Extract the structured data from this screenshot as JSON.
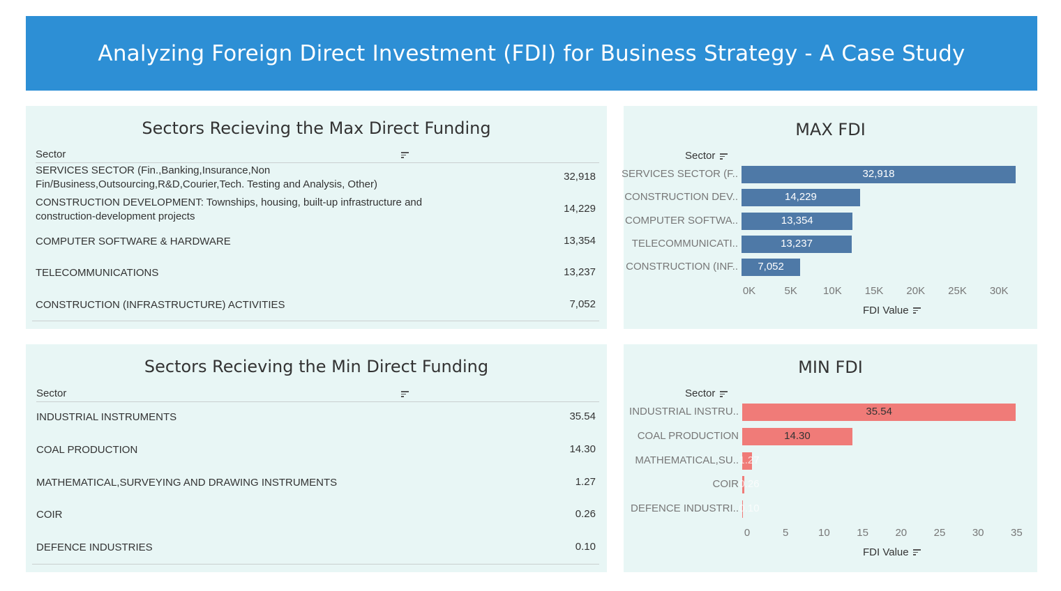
{
  "header": {
    "title": "Analyzing Foreign Direct Investment (FDI) for Business Strategy - A Case Study"
  },
  "colors": {
    "banner": "#2d8fd5",
    "panel_bg": "#e8f6f5",
    "max_bar": "#4e79a7",
    "min_bar": "#f07b78"
  },
  "max_table": {
    "title": "Sectors Recieving the Max Direct Funding",
    "column_header": "Sector",
    "rows": [
      {
        "sector": "SERVICES SECTOR (Fin.,Banking,Insurance,Non Fin/Business,Outsourcing,R&D,Courier,Tech. Testing and Analysis, Other)",
        "value": "32,918"
      },
      {
        "sector": "CONSTRUCTION DEVELOPMENT: Townships, housing, built-up infrastructure and construction-development projects",
        "value": "14,229"
      },
      {
        "sector": "COMPUTER SOFTWARE & HARDWARE",
        "value": "13,354"
      },
      {
        "sector": "TELECOMMUNICATIONS",
        "value": "13,237"
      },
      {
        "sector": "CONSTRUCTION (INFRASTRUCTURE) ACTIVITIES",
        "value": "7,052"
      }
    ]
  },
  "min_table": {
    "title": "Sectors Recieving the Min Direct Funding",
    "column_header": "Sector",
    "rows": [
      {
        "sector": "INDUSTRIAL INSTRUMENTS",
        "value": "35.54"
      },
      {
        "sector": "COAL PRODUCTION",
        "value": "14.30"
      },
      {
        "sector": "MATHEMATICAL,SURVEYING AND DRAWING INSTRUMENTS",
        "value": "1.27"
      },
      {
        "sector": "COIR",
        "value": "0.26"
      },
      {
        "sector": "DEFENCE INDUSTRIES",
        "value": "0.10"
      }
    ]
  },
  "chart_data": [
    {
      "type": "bar",
      "orientation": "horizontal",
      "title": "MAX FDI",
      "ylabel": "Sector",
      "xlabel": "FDI Value",
      "categories": [
        "SERVICES SECTOR (F..",
        "CONSTRUCTION DEV..",
        "COMPUTER SOFTWA..",
        "TELECOMMUNICATI..",
        "CONSTRUCTION (INF.."
      ],
      "values": [
        32918,
        14229,
        13354,
        13237,
        7052
      ],
      "value_labels": [
        "32,918",
        "14,229",
        "13,354",
        "13,237",
        "7,052"
      ],
      "xlim": [
        0,
        33000
      ],
      "ticks": [
        0,
        5000,
        10000,
        15000,
        20000,
        25000,
        30000
      ],
      "tick_labels": [
        "0K",
        "5K",
        "10K",
        "15K",
        "20K",
        "25K",
        "30K"
      ],
      "color": "#4e79a7",
      "value_label_color": "#ffffff"
    },
    {
      "type": "bar",
      "orientation": "horizontal",
      "title": "MIN FDI",
      "ylabel": "Sector",
      "xlabel": "FDI Value",
      "categories": [
        "INDUSTRIAL INSTRU..",
        "COAL PRODUCTION",
        "MATHEMATICAL,SU..",
        "COIR",
        "DEFENCE INDUSTRI.."
      ],
      "values": [
        35.54,
        14.3,
        1.27,
        0.26,
        0.1
      ],
      "value_labels": [
        "35.54",
        "14.30",
        "1.27",
        "0.26",
        "0.10"
      ],
      "xlim": [
        0,
        35.6
      ],
      "ticks": [
        0,
        5,
        10,
        15,
        20,
        25,
        30,
        35
      ],
      "tick_labels": [
        "0",
        "5",
        "10",
        "15",
        "20",
        "25",
        "30",
        "35"
      ],
      "color": "#f07b78",
      "value_label_color": "#333333"
    }
  ]
}
